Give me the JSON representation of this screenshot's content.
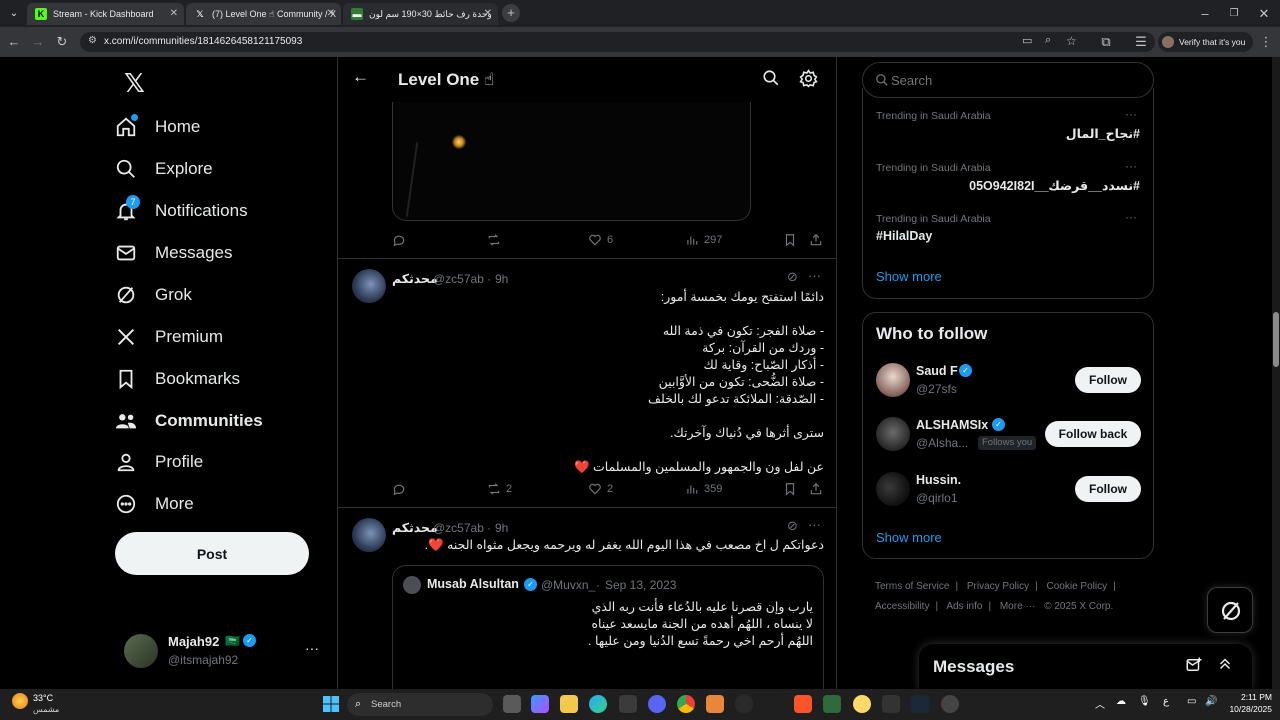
{
  "browser": {
    "tabs": [
      {
        "title": "Stream - Kick Dashboard",
        "icon": "kick-icon",
        "active": false
      },
      {
        "title": "(7) Level One ☝ Community / X",
        "icon": "x-icon",
        "active": true
      },
      {
        "title": "وحدة رف حائط 30×190 سم لون",
        "icon": "store-icon",
        "active": false
      }
    ],
    "url": "x.com/i/communities/1814626458121175093",
    "profile_text": "Verify that it's you"
  },
  "nav": {
    "items": [
      {
        "label": "Home",
        "icon": "home-icon"
      },
      {
        "label": "Explore",
        "icon": "search-icon"
      },
      {
        "label": "Notifications",
        "icon": "bell-icon",
        "badge": "7"
      },
      {
        "label": "Messages",
        "icon": "mail-icon"
      },
      {
        "label": "Grok",
        "icon": "grok-icon"
      },
      {
        "label": "Premium",
        "icon": "x-logo-icon"
      },
      {
        "label": "Bookmarks",
        "icon": "bookmark-icon"
      },
      {
        "label": "Communities",
        "icon": "people-icon"
      },
      {
        "label": "Profile",
        "icon": "person-icon"
      },
      {
        "label": "More",
        "icon": "more-circle-icon"
      }
    ],
    "post_label": "Post",
    "account": {
      "name": "Majah92",
      "flag": "🇸🇦",
      "handle": "@itsmajah92"
    }
  },
  "header": {
    "title": "Level One ☝"
  },
  "tweets": [
    {
      "stats": {
        "reply": "",
        "retweet": "",
        "like": "6",
        "views": "297"
      }
    },
    {
      "name": "محدثكم",
      "handle": "@zc57ab",
      "time": "9h",
      "lines": [
        "دائمًا استفتح يومك بخمسة أمور:",
        "",
        "- صلاة الفجر: تكون في ذمة الله",
        "- وردك من القرآن: بركة",
        "- أذكار الصّباح: وقاية لك",
        "- صلاة الضُّحى: تكون من الأوَّابين",
        "- الصّدقة: الملائكة تدعو لك بالخلف",
        "",
        "سترى أثرها في دُنياك وآخرتك.",
        "",
        "عن لفل ون والجمهور والمسلمين والمسلمات ❤️"
      ],
      "stats": {
        "reply": "",
        "retweet": "2",
        "like": "2",
        "views": "359"
      }
    },
    {
      "name": "محدثكم",
      "handle": "@zc57ab",
      "time": "9h",
      "text": "دعواتكم ل اخ مصعب في هذا اليوم الله يغفر له ويرحمه ويجعل مثواه الجنه ❤️.",
      "quote": {
        "name": "Musab Alsultan",
        "handle": "@Muvxn_",
        "date": "Sep 13, 2023",
        "lines": [
          "يارب وإن قصرنا عليه بالدُعاء فأنت ربه الذي",
          "لا ينساه ، اللهُم أهده من الجنة مايسعد عيناه",
          "اللهُم أرحم اخي رحمةً تسع الدُنيا ومن عليها ."
        ]
      }
    }
  ],
  "search": {
    "placeholder": "Search"
  },
  "trends": [
    {
      "context": "Trending in Saudi Arabia",
      "title": "#نجاح_المال"
    },
    {
      "context": "Trending in Saudi Arabia",
      "title": "#نسدد__قرضك__05O942I82I"
    },
    {
      "context": "Trending in Saudi Arabia",
      "title": "#HilalDay"
    }
  ],
  "trends_show_more": "Show more",
  "who_to_follow": {
    "title": "Who to follow",
    "users": [
      {
        "name": "Saud F",
        "handle": "@27sfs",
        "button": "Follow",
        "verified": true,
        "follows_you": ""
      },
      {
        "name": "ALSHAMSIx",
        "handle": "@Alsha...",
        "button": "Follow back",
        "verified": true,
        "follows_you": "Follows you"
      },
      {
        "name": "Hussin.",
        "handle": "@qirlo1",
        "button": "Follow",
        "verified": false,
        "follows_you": ""
      }
    ],
    "show_more": "Show more"
  },
  "footer": {
    "links": [
      "Terms of Service",
      "Privacy Policy",
      "Cookie Policy",
      "Accessibility",
      "Ads info",
      "More ···",
      "© 2025 X Corp."
    ]
  },
  "messages_drawer": {
    "title": "Messages"
  },
  "taskbar": {
    "weather_temp": "33°C",
    "weather_desc": "مشمس",
    "search_label": "Search",
    "lang": "ع",
    "time": "2:11 PM",
    "date": "10/28/2025"
  },
  "colors": {
    "accent": "#1d9bf0",
    "background": "#000000",
    "border": "#2f3336",
    "muted": "#71767b"
  }
}
